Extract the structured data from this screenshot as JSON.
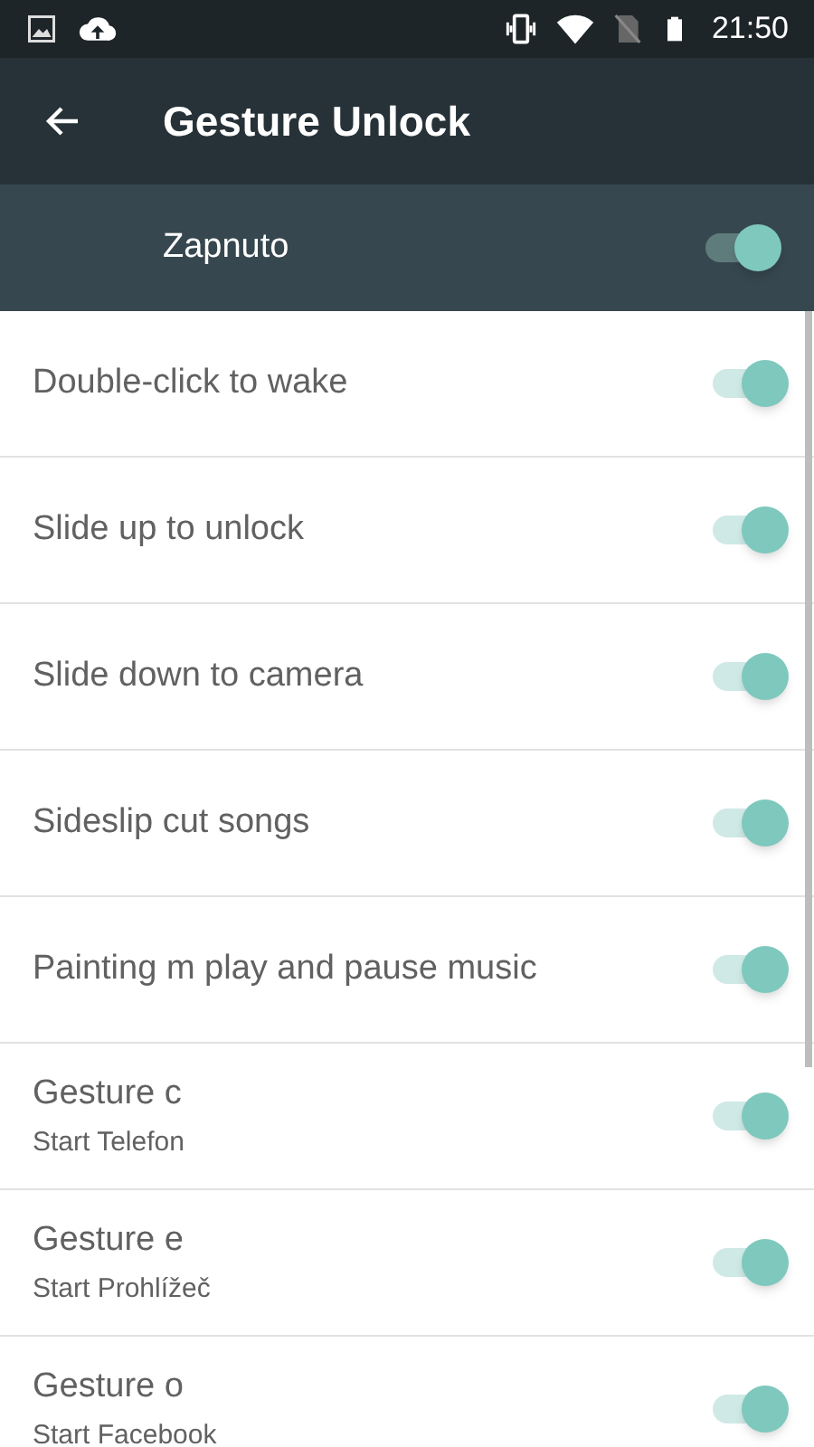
{
  "status_bar": {
    "time": "21:50"
  },
  "app_bar": {
    "title": "Gesture Unlock"
  },
  "master_switch": {
    "label": "Zapnuto",
    "on": true
  },
  "items": [
    {
      "title": "Double-click to wake",
      "on": true
    },
    {
      "title": "Slide up to unlock",
      "on": true
    },
    {
      "title": "Slide down to camera",
      "on": true
    },
    {
      "title": "Sideslip cut songs",
      "on": true
    },
    {
      "title": "Painting m play and pause music",
      "on": true
    },
    {
      "title": "Gesture c",
      "subtitle": "Start Telefon",
      "on": true
    },
    {
      "title": "Gesture e",
      "subtitle": "Start Prohlížeč",
      "on": true
    },
    {
      "title": "Gesture o",
      "subtitle": "Start Facebook",
      "on": true
    }
  ]
}
